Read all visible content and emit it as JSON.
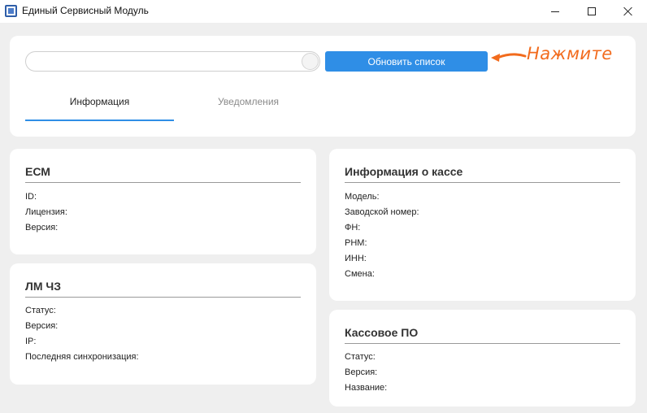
{
  "window": {
    "title": "Единый Сервисный Модуль",
    "icon": "app-icon"
  },
  "toolbar": {
    "search_value": "",
    "refresh_label": "Обновить список"
  },
  "tabs": [
    {
      "label": "Информация",
      "active": true
    },
    {
      "label": "Уведомления",
      "active": false
    }
  ],
  "annotation": {
    "text": "Нажмите",
    "color": "#f26b1d"
  },
  "ecm": {
    "title": "ЕСМ",
    "fields": [
      "ID:",
      "Лицензия:",
      "Версия:"
    ]
  },
  "lm": {
    "title": "ЛМ ЧЗ",
    "fields": [
      "Статус:",
      "Версия:",
      "IP:",
      "Последняя синхронизация:"
    ]
  },
  "kassa": {
    "title": "Информация о кассе",
    "fields": [
      "Модель:",
      "Заводской номер:",
      "ФН:",
      "РНМ:",
      "ИНН:",
      "Смена:"
    ]
  },
  "kassa_po": {
    "title": "Кассовое ПО",
    "fields": [
      "Статус:",
      "Версия:",
      "Название:"
    ]
  },
  "colors": {
    "accent": "#2f8ee6",
    "background": "#efefef",
    "annotation": "#f26b1d"
  }
}
